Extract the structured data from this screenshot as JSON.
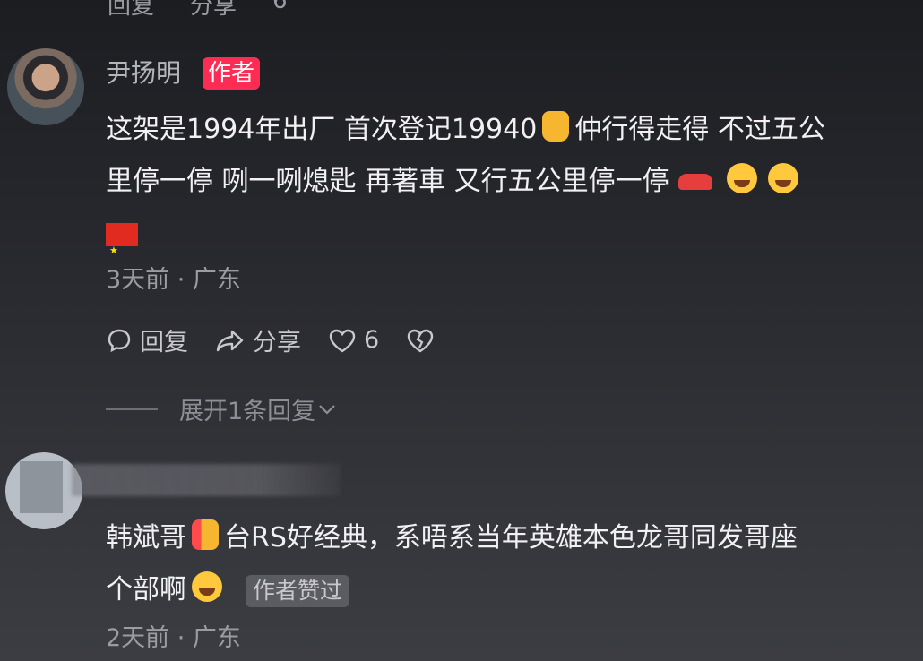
{
  "top_cut": [
    "回复",
    "分享",
    "6"
  ],
  "comments": [
    {
      "username": "尹扬明",
      "badge": "作者",
      "text_line1": "这架是1994年出厂 首次登记19940",
      "text_line1b": "仲行得走得 不过五公",
      "text_line2": "里停一停 咧一咧熄匙 再著車 又行五公里停一停",
      "meta": "3天前 · 广东",
      "actions": {
        "reply": "回复",
        "share": "分享",
        "likes": "6"
      },
      "expand": "展开1条回复"
    },
    {
      "text_line1a": "韩斌哥",
      "text_line1b": "台RS好经典，系唔系当年英雄本色龙哥同发哥座",
      "text_line2": "个部啊",
      "liked_tag": "作者赞过",
      "meta": "2天前 · 广东"
    }
  ]
}
